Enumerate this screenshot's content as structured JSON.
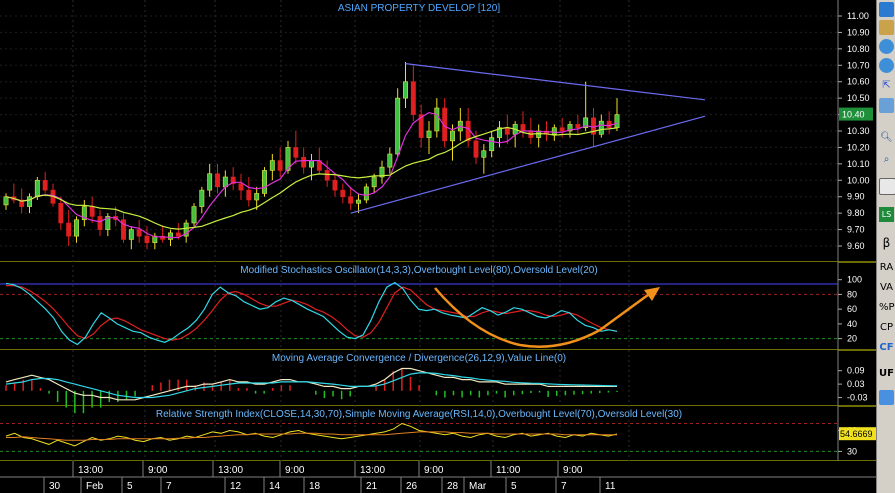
{
  "chart_data": {
    "type": "candlestick",
    "title": "ASIAN PROPERTY DEVELOP [120]",
    "last_price_label": "10.40",
    "price_ticks": [
      "11.00",
      "10.90",
      "10.80",
      "10.70",
      "10.60",
      "10.50",
      "10.40",
      "10.30",
      "10.20",
      "10.10",
      "10.00",
      "9.90",
      "9.80",
      "9.70",
      "9.60"
    ],
    "ylim": [
      9.55,
      11.05
    ],
    "candles": [
      [
        9.85,
        9.92,
        9.82,
        9.9
      ],
      [
        9.9,
        9.98,
        9.86,
        9.88
      ],
      [
        9.88,
        9.95,
        9.8,
        9.84
      ],
      [
        9.84,
        9.92,
        9.8,
        9.9
      ],
      [
        9.9,
        10.02,
        9.88,
        10.0
      ],
      [
        10.0,
        10.05,
        9.92,
        9.94
      ],
      [
        9.94,
        9.98,
        9.84,
        9.86
      ],
      [
        9.86,
        9.9,
        9.7,
        9.74
      ],
      [
        9.74,
        9.82,
        9.6,
        9.66
      ],
      [
        9.66,
        9.78,
        9.62,
        9.76
      ],
      [
        9.76,
        9.88,
        9.72,
        9.84
      ],
      [
        9.84,
        9.9,
        9.74,
        9.78
      ],
      [
        9.78,
        9.82,
        9.66,
        9.7
      ],
      [
        9.7,
        9.8,
        9.66,
        9.78
      ],
      [
        9.78,
        9.84,
        9.72,
        9.76
      ],
      [
        9.76,
        9.8,
        9.62,
        9.64
      ],
      [
        9.64,
        9.72,
        9.58,
        9.7
      ],
      [
        9.7,
        9.76,
        9.62,
        9.66
      ],
      [
        9.66,
        9.72,
        9.58,
        9.62
      ],
      [
        9.62,
        9.68,
        9.58,
        9.66
      ],
      [
        9.66,
        9.72,
        9.62,
        9.64
      ],
      [
        9.64,
        9.7,
        9.6,
        9.68
      ],
      [
        9.68,
        9.74,
        9.64,
        9.66
      ],
      [
        9.66,
        9.76,
        9.62,
        9.74
      ],
      [
        9.74,
        9.86,
        9.72,
        9.84
      ],
      [
        9.84,
        9.96,
        9.8,
        9.94
      ],
      [
        9.94,
        10.1,
        9.9,
        10.04
      ],
      [
        10.04,
        10.1,
        9.92,
        9.96
      ],
      [
        9.96,
        10.06,
        9.9,
        10.02
      ],
      [
        10.02,
        10.08,
        9.94,
        9.98
      ],
      [
        9.98,
        10.04,
        9.88,
        9.94
      ],
      [
        9.94,
        10.02,
        9.84,
        9.88
      ],
      [
        9.88,
        9.96,
        9.82,
        9.92
      ],
      [
        9.92,
        10.08,
        9.9,
        10.06
      ],
      [
        10.06,
        10.16,
        10.0,
        10.12
      ],
      [
        10.12,
        10.2,
        10.02,
        10.06
      ],
      [
        10.06,
        10.24,
        10.04,
        10.2
      ],
      [
        10.2,
        10.3,
        10.1,
        10.14
      ],
      [
        10.14,
        10.2,
        10.04,
        10.08
      ],
      [
        10.08,
        10.16,
        10.0,
        10.12
      ],
      [
        10.12,
        10.2,
        10.04,
        10.06
      ],
      [
        10.06,
        10.12,
        9.96,
        10.0
      ],
      [
        10.0,
        10.04,
        9.9,
        9.94
      ],
      [
        9.94,
        9.98,
        9.86,
        9.9
      ],
      [
        9.9,
        9.96,
        9.82,
        9.86
      ],
      [
        9.86,
        9.92,
        9.8,
        9.88
      ],
      [
        9.88,
        9.98,
        9.86,
        9.96
      ],
      [
        9.96,
        10.04,
        9.92,
        10.02
      ],
      [
        10.02,
        10.12,
        9.98,
        10.08
      ],
      [
        10.08,
        10.2,
        10.04,
        10.16
      ],
      [
        10.16,
        10.56,
        10.14,
        10.5
      ],
      [
        10.5,
        10.72,
        10.44,
        10.6
      ],
      [
        10.6,
        10.7,
        10.36,
        10.4
      ],
      [
        10.4,
        10.46,
        10.2,
        10.26
      ],
      [
        10.26,
        10.36,
        10.16,
        10.3
      ],
      [
        10.3,
        10.5,
        10.26,
        10.44
      ],
      [
        10.44,
        10.5,
        10.2,
        10.24
      ],
      [
        10.24,
        10.34,
        10.12,
        10.3
      ],
      [
        10.3,
        10.44,
        10.24,
        10.36
      ],
      [
        10.36,
        10.44,
        10.2,
        10.24
      ],
      [
        10.24,
        10.3,
        10.1,
        10.14
      ],
      [
        10.14,
        10.22,
        10.04,
        10.18
      ],
      [
        10.18,
        10.3,
        10.14,
        10.26
      ],
      [
        10.26,
        10.36,
        10.2,
        10.32
      ],
      [
        10.32,
        10.4,
        10.22,
        10.28
      ],
      [
        10.28,
        10.36,
        10.2,
        10.34
      ],
      [
        10.34,
        10.42,
        10.26,
        10.3
      ],
      [
        10.3,
        10.38,
        10.22,
        10.26
      ],
      [
        10.26,
        10.34,
        10.2,
        10.3
      ],
      [
        10.3,
        10.36,
        10.24,
        10.28
      ],
      [
        10.28,
        10.34,
        10.24,
        10.32
      ],
      [
        10.32,
        10.38,
        10.26,
        10.3
      ],
      [
        10.3,
        10.36,
        10.26,
        10.34
      ],
      [
        10.34,
        10.4,
        10.28,
        10.32
      ],
      [
        10.32,
        10.6,
        10.3,
        10.38
      ],
      [
        10.38,
        10.44,
        10.2,
        10.28
      ],
      [
        10.28,
        10.4,
        10.26,
        10.36
      ],
      [
        10.36,
        10.42,
        10.28,
        10.32
      ],
      [
        10.32,
        10.5,
        10.3,
        10.4
      ]
    ],
    "indicators": [
      {
        "title": "Modified Stochastics Oscillator(14,3,3),Overbought Level(80),Oversold Level(20)",
        "ticks": [
          "100",
          "80",
          "60",
          "40",
          "20"
        ],
        "range": [
          10,
          105
        ],
        "levels": [
          80,
          20
        ],
        "k": [
          95,
          93,
          88,
          80,
          70,
          60,
          48,
          30,
          18,
          12,
          22,
          40,
          55,
          48,
          40,
          35,
          30,
          28,
          22,
          18,
          15,
          20,
          28,
          35,
          45,
          60,
          80,
          90,
          82,
          78,
          70,
          65,
          60,
          62,
          70,
          75,
          72,
          66,
          60,
          55,
          50,
          40,
          30,
          22,
          20,
          25,
          45,
          70,
          90,
          96,
          88,
          72,
          60,
          58,
          60,
          55,
          52,
          50,
          48,
          55,
          62,
          58,
          52,
          56,
          62,
          60,
          55,
          50,
          48,
          52,
          58,
          55,
          45,
          38,
          35,
          30,
          32,
          30
        ],
        "d": [
          92,
          92,
          90,
          85,
          78,
          70,
          60,
          48,
          35,
          24,
          20,
          26,
          38,
          46,
          48,
          44,
          38,
          32,
          28,
          24,
          20,
          18,
          20,
          26,
          34,
          45,
          58,
          72,
          82,
          84,
          80,
          74,
          68,
          64,
          64,
          68,
          72,
          70,
          66,
          60,
          56,
          50,
          42,
          32,
          24,
          22,
          28,
          42,
          62,
          82,
          90,
          86,
          76,
          66,
          60,
          58,
          56,
          54,
          50,
          50,
          55,
          58,
          56,
          54,
          56,
          58,
          58,
          56,
          52,
          50,
          52,
          55,
          52,
          46,
          40,
          35,
          32,
          30
        ]
      },
      {
        "title": "Moving Average Convergence / Divergence(26,12,9),Value Line(0)",
        "ticks": [
          "0.09",
          "0.03",
          "-0.03"
        ],
        "range": [
          -0.05,
          0.12
        ],
        "level": 0,
        "macd": [
          0.04,
          0.05,
          0.06,
          0.07,
          0.06,
          0.05,
          0.03,
          0.01,
          -0.01,
          -0.02,
          -0.02,
          -0.03,
          -0.03,
          -0.04,
          -0.04,
          -0.04,
          -0.03,
          -0.02,
          -0.01,
          0.0,
          0.01,
          0.02,
          0.02,
          0.03,
          0.03,
          0.04,
          0.05,
          0.04,
          0.04,
          0.03,
          0.03,
          0.04,
          0.05,
          0.05,
          0.04,
          0.04,
          0.03,
          0.02,
          0.02,
          0.01,
          0.01,
          0.02,
          0.02,
          0.03,
          0.05,
          0.08,
          0.1,
          0.1,
          0.09,
          0.08,
          0.07,
          0.06,
          0.06,
          0.05,
          0.05,
          0.04,
          0.04,
          0.04,
          0.03,
          0.03,
          0.03,
          0.03,
          0.03,
          0.02,
          0.02,
          0.02,
          0.02,
          0.02,
          0.02,
          0.02,
          0.02,
          0.02
        ],
        "signal": [
          0.03,
          0.035,
          0.04,
          0.05,
          0.055,
          0.055,
          0.05,
          0.04,
          0.03,
          0.02,
          0.01,
          0.0,
          -0.01,
          -0.02,
          -0.025,
          -0.03,
          -0.03,
          -0.03,
          -0.025,
          -0.02,
          -0.01,
          0.0,
          0.01,
          0.015,
          0.02,
          0.025,
          0.03,
          0.035,
          0.035,
          0.035,
          0.035,
          0.035,
          0.04,
          0.04,
          0.04,
          0.04,
          0.037,
          0.033,
          0.03,
          0.025,
          0.02,
          0.02,
          0.02,
          0.022,
          0.03,
          0.045,
          0.06,
          0.075,
          0.08,
          0.08,
          0.078,
          0.072,
          0.068,
          0.062,
          0.058,
          0.052,
          0.048,
          0.045,
          0.042,
          0.038,
          0.036,
          0.034,
          0.033,
          0.031,
          0.029,
          0.028,
          0.027,
          0.026,
          0.025,
          0.024,
          0.023,
          0.022
        ]
      },
      {
        "title": "Relative Strength Index(CLOSE,14,30,70),Simple Moving Average(RSI,14,0),Overbought Level(70),Oversold Level(30)",
        "ticks": [
          "60",
          "30"
        ],
        "range": [
          22,
          75
        ],
        "levels": [
          70,
          30
        ],
        "last_label": "54.6669",
        "rsi": [
          52,
          56,
          50,
          48,
          44,
          40,
          46,
          42,
          38,
          44,
          50,
          46,
          48,
          52,
          50,
          46,
          44,
          48,
          50,
          46,
          48,
          52,
          50,
          54,
          58,
          56,
          60,
          58,
          54,
          56,
          52,
          50,
          54,
          58,
          60,
          56,
          54,
          52,
          50,
          48,
          50,
          52,
          54,
          56,
          58,
          62,
          70,
          66,
          60,
          58,
          56,
          54,
          56,
          52,
          50,
          54,
          56,
          52,
          50,
          54,
          56,
          52,
          54,
          56,
          52,
          50,
          54,
          52,
          56,
          54,
          52,
          55
        ],
        "sma": [
          50,
          50,
          51,
          50,
          49,
          48,
          47,
          46,
          46,
          46,
          47,
          47,
          47,
          48,
          48,
          48,
          48,
          48,
          48,
          48,
          49,
          49,
          50,
          50,
          51,
          52,
          53,
          54,
          54,
          55,
          55,
          55,
          55,
          55,
          56,
          56,
          56,
          55,
          55,
          54,
          54,
          54,
          54,
          54,
          54,
          55,
          56,
          57,
          58,
          58,
          58,
          58,
          57,
          57,
          56,
          56,
          56,
          55,
          55,
          55,
          55,
          55,
          55,
          55,
          55,
          54,
          54,
          54,
          54,
          54,
          54,
          54
        ]
      }
    ],
    "x_time_labels": [
      "13:00",
      "9:00",
      "13:00",
      "9:00",
      "13:00",
      "9:00",
      "11:00",
      "9:00"
    ],
    "x_date_labels": [
      "30",
      "Feb",
      "5",
      "7",
      "12",
      "14",
      "18",
      "21",
      "26",
      "28",
      "Mar",
      "5",
      "7",
      "11"
    ]
  },
  "toolbar": {
    "items": [
      "LS",
      "β",
      "RA",
      "VA",
      "%P",
      "CP",
      "CF",
      "UF"
    ]
  }
}
